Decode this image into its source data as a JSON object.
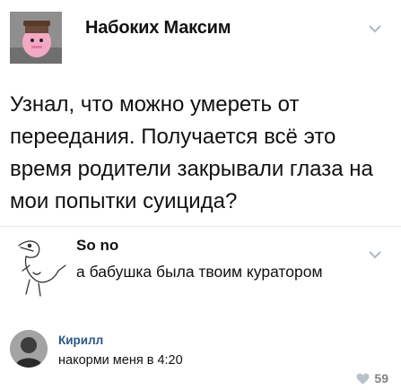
{
  "post": {
    "author": "Набоких Максим",
    "text": "Узнал, что можно умереть от переедания. Получается всё это время родители закрывали глаза на мои попытки суицида?"
  },
  "comments": [
    {
      "author": "So no",
      "text": "а бабушка была твоим куратором"
    },
    {
      "author": "Кирилл",
      "text": "накорми меня в 4:20",
      "likes": "59"
    }
  ],
  "colors": {
    "link": "#2a5885",
    "muted": "#828282",
    "chevron": "#b0b8c1"
  },
  "icons": [
    "chevron-down-icon",
    "like-icon"
  ]
}
